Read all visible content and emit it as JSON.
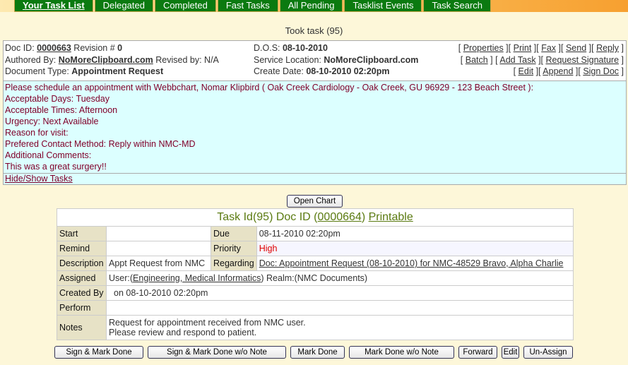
{
  "tabs": [
    "Your Task List",
    "Delegated",
    "Completed",
    "Fast Tasks",
    "All Pending",
    "Tasklist Events",
    "Task Search"
  ],
  "status": "Took task (95)",
  "doc": {
    "doc_id_label": "Doc ID: ",
    "doc_id": "0000663",
    "revision_label": " Revision # ",
    "revision": "0",
    "authored_label": "Authored By: ",
    "authored": "NoMoreClipboard.com",
    "revised": " Revised by: N/A",
    "type_label": "Document Type: ",
    "type": "Appointment Request",
    "dos_label": "D.O.S: ",
    "dos": "08-10-2010",
    "loc_label": "Service Location: ",
    "loc": "NoMoreClipboard.com",
    "create_label": "Create Date: ",
    "create": "08-10-2010 02:20pm",
    "links": [
      "Properties",
      "Print",
      "Fax",
      "Send",
      "Reply",
      "Batch",
      "Add Task",
      "Request Signature",
      "Edit",
      "Append",
      "Sign Doc"
    ],
    "body": [
      "Please schedule an appointment with Webbchart,  Nomar Klipbird ( Oak Creek Cardiology -  Oak Creek, GU 96929 - 123 Beach Street  ):",
      "Acceptable Days: Tuesday",
      "Acceptable Times: Afternoon",
      "Urgency: Next Available",
      "Reason for visit:",
      "Prefered Contact Method: Reply within NMC-MD",
      "Additional Comments:",
      "This was a great surgery!!"
    ],
    "hide_show": "Hide/Show Tasks"
  },
  "open_chart": "Open Chart",
  "task": {
    "title_prefix": "Task Id(95) Doc ID (",
    "doc_id": "0000664",
    "title_mid": ") ",
    "printable": "Printable",
    "labels": {
      "start": "Start",
      "due": "Due",
      "remind": "Remind",
      "priority": "Priority",
      "description": "Description",
      "regarding": "Regarding",
      "assigned": "Assigned",
      "created_by": "Created By",
      "perform": "Perform",
      "notes": "Notes"
    },
    "start": "",
    "due": "08-11-2010 02:20pm",
    "remind": "",
    "priority": "High",
    "priority_color": "#e00000",
    "description": "Appt Request from NMC",
    "regarding": "Doc: Appointment Request (08-10-2010) for NMC-48529 Bravo, Alpha Charlie",
    "assigned_prefix": "User:(",
    "assigned_user": "Engineering, Medical Informatics",
    "assigned_suffix": ") Realm:(NMC Documents)",
    "created_by": "on 08-10-2010 02:20pm",
    "perform": "",
    "notes": [
      "Request for appointment received from NMC user.",
      "Please review and respond to patient."
    ]
  },
  "actions": [
    "Sign & Mark Done",
    "Sign & Mark Done w/o Note",
    "Mark Done",
    "Mark Done w/o Note",
    "Forward",
    "Edit",
    "Un-Assign"
  ]
}
